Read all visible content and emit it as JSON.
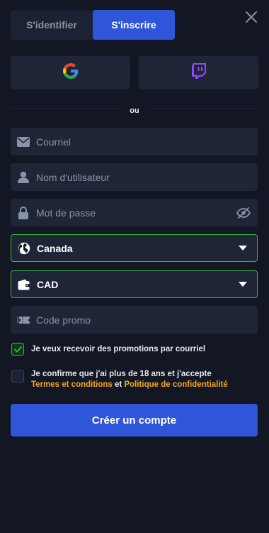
{
  "tabs": {
    "login_label": "S'identifier",
    "register_label": "S'inscrire"
  },
  "divider": {
    "text": "ou"
  },
  "form": {
    "email_placeholder": "Courriel",
    "username_placeholder": "Nom d'utilisateur",
    "password_placeholder": "Mot de passe",
    "country_value": "Canada",
    "currency_value": "CAD",
    "promo_placeholder": "Code promo"
  },
  "checkboxes": {
    "promo_label": "Je veux recevoir des promotions par courriel",
    "age_line1": "Je confirme que j'ai plus de 18 ans et j'accepte",
    "terms_link": "Termes et conditions",
    "and_text": "et",
    "privacy_link": "Politique de confidentialité"
  },
  "cta": {
    "label": "Créer un compte"
  },
  "colors": {
    "accent": "#2f56d8",
    "link": "#f5a623",
    "valid": "#3eb53e",
    "background": "#121723"
  }
}
